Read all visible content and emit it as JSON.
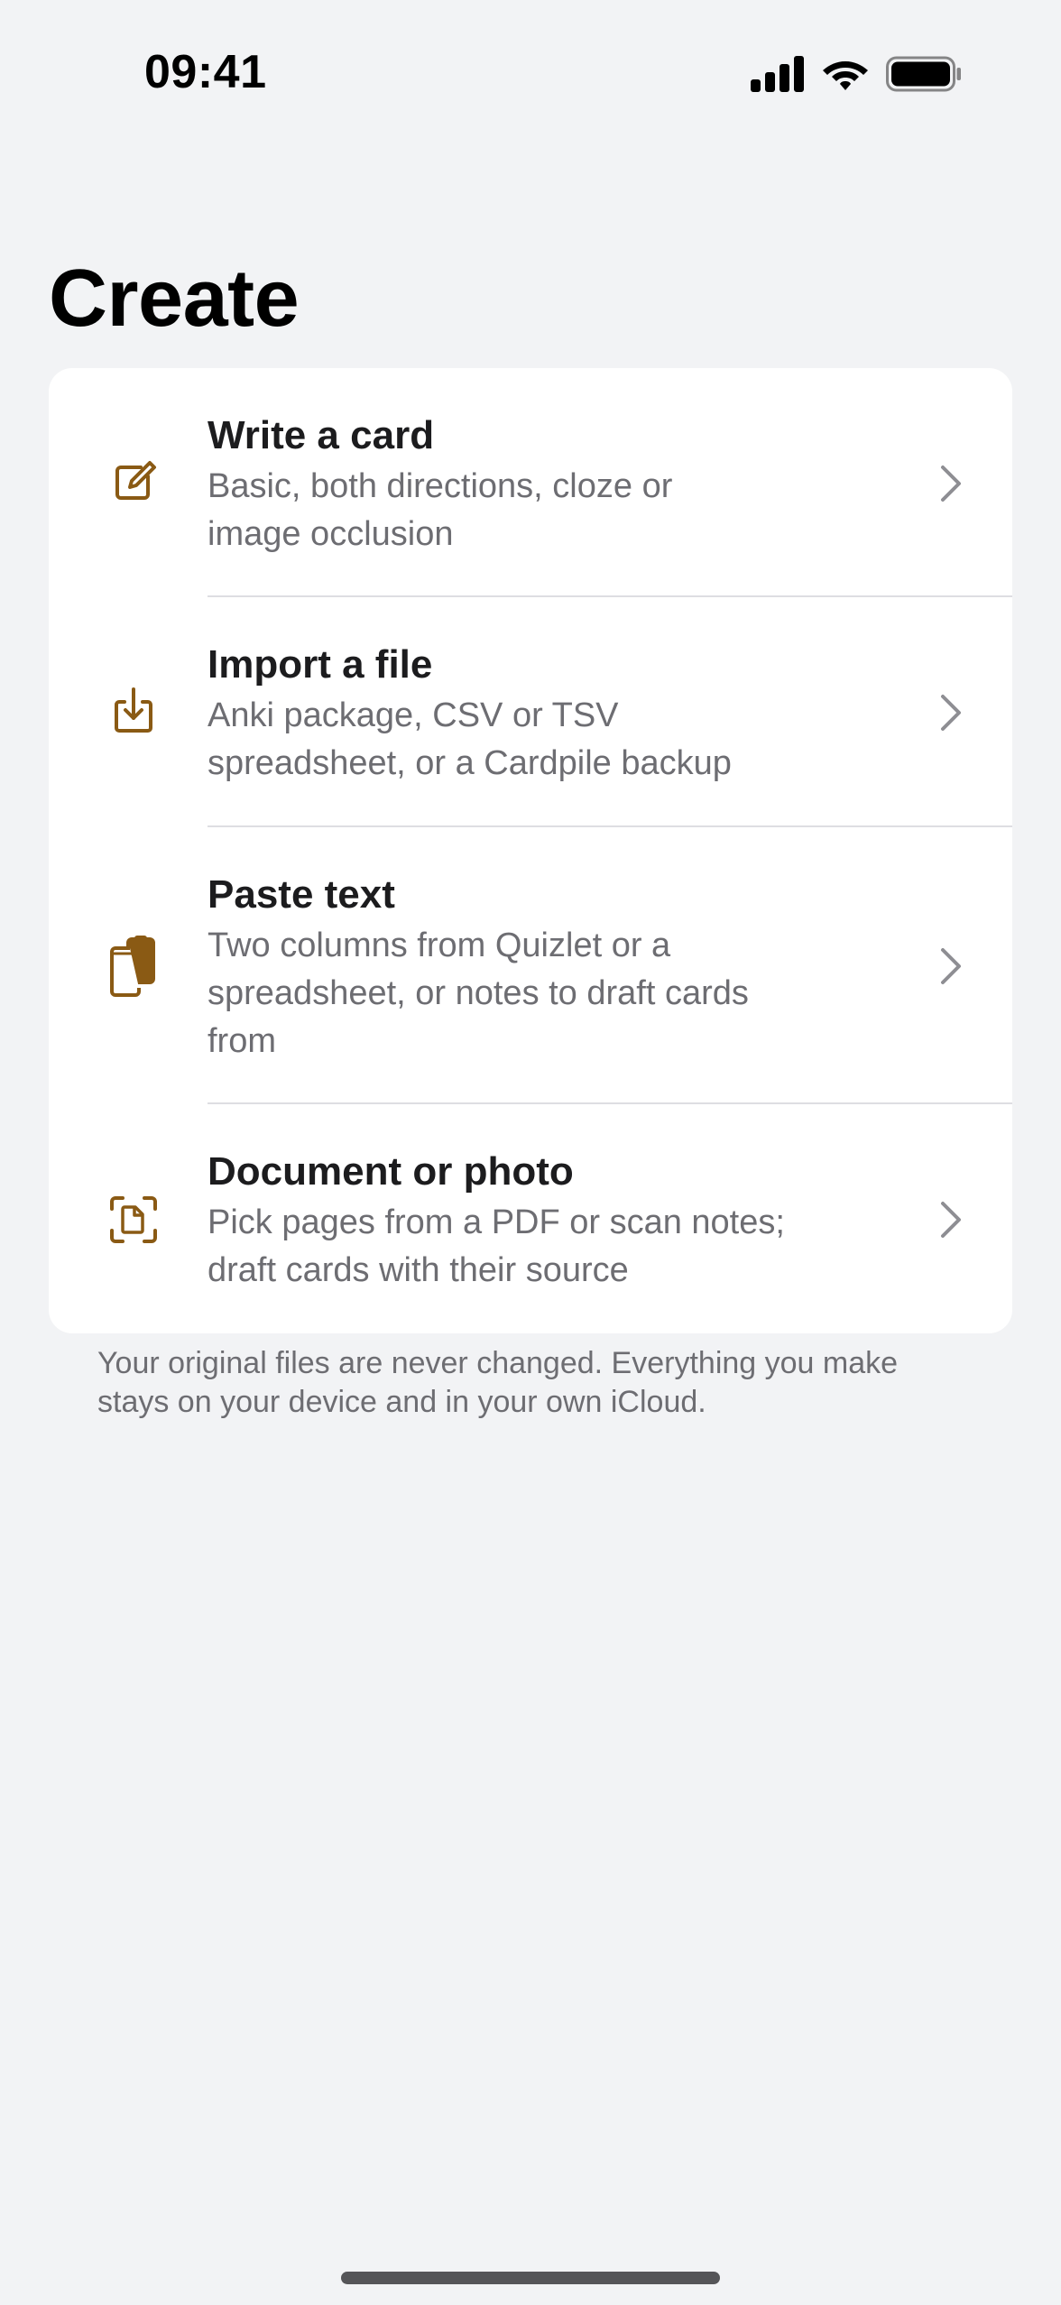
{
  "status_bar": {
    "time": "09:41",
    "icons": [
      "cellular-signal-icon",
      "wifi-icon",
      "battery-icon"
    ]
  },
  "page": {
    "title": "Create"
  },
  "accent_color": "#8a5a14",
  "options": [
    {
      "title": "Write a card",
      "subtitle_lines": [
        "Basic, both directions, cloze or",
        "image occlusion"
      ],
      "icon": "compose-icon"
    },
    {
      "title": "Import a file",
      "subtitle_lines": [
        "Anki package, CSV or TSV",
        "spreadsheet, or a Cardpile backup"
      ],
      "icon": "import-icon"
    },
    {
      "title": "Paste text",
      "subtitle_lines": [
        "Two columns from Quizlet or a",
        "spreadsheet, or notes to draft cards",
        "from"
      ],
      "icon": "clipboard-icon"
    },
    {
      "title": "Document or photo",
      "subtitle_lines": [
        "Pick pages from a PDF or scan notes;",
        "draft cards with their source"
      ],
      "icon": "document-scan-icon"
    }
  ],
  "footer": {
    "lines": [
      "Your original files are never changed. Everything you make",
      "stays on your device and in your own iCloud."
    ]
  }
}
